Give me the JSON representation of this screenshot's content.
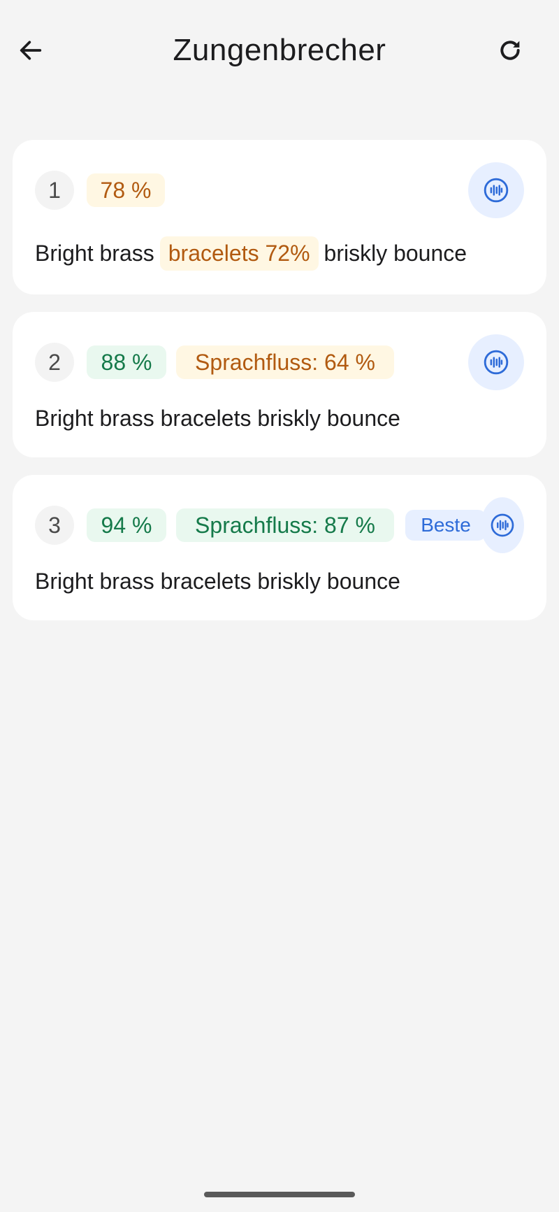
{
  "header": {
    "title": "Zungenbrecher",
    "back_icon": "arrow-left-icon",
    "refresh_icon": "refresh-icon"
  },
  "colors": {
    "background": "#f4f4f4",
    "card": "#ffffff",
    "warn_bg": "#fff7e3",
    "warn_text": "#b15a10",
    "good_bg": "#e9f8ef",
    "good_text": "#157a4a",
    "accent_bg": "#e7efff",
    "accent": "#2e6bd8"
  },
  "attempts": [
    {
      "number": "1",
      "score": "78 %",
      "phrase_before": "Bright brass",
      "phrase_highlight": "bracelets 72%",
      "phrase_after": "briskly bounce",
      "play_icon": "audio-waveform-icon"
    },
    {
      "number": "2",
      "score": "88 %",
      "fluency": "Sprachfluss: 64 %",
      "phrase": "Bright brass bracelets briskly bounce",
      "play_icon": "audio-waveform-icon"
    },
    {
      "number": "3",
      "score": "94 %",
      "fluency": "Sprachfluss: 87 %",
      "best_label": "Beste",
      "phrase": "Bright brass bracelets briskly bounce",
      "play_icon": "audio-waveform-icon"
    }
  ]
}
